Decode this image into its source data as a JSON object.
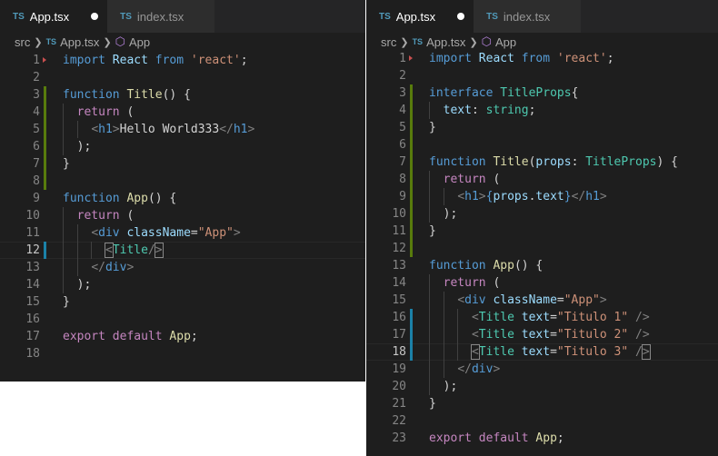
{
  "left": {
    "tabs": [
      {
        "icon": "TS",
        "label": "App.tsx",
        "active": true,
        "dirty": true
      },
      {
        "icon": "TS",
        "label": "index.tsx",
        "active": false,
        "dirty": false
      }
    ],
    "breadcrumb": {
      "folder": "src",
      "file_icon": "TS",
      "file": "App.tsx",
      "symbol": "App"
    },
    "lines": [
      {
        "n": "1",
        "tokens": [
          [
            "kw",
            "import"
          ],
          [
            "pl",
            " "
          ],
          [
            "id",
            "React"
          ],
          [
            "pl",
            " "
          ],
          [
            "kw",
            "from"
          ],
          [
            "pl",
            " "
          ],
          [
            "str",
            "'react'"
          ],
          [
            "pl",
            ";"
          ]
        ]
      },
      {
        "n": "2",
        "tokens": []
      },
      {
        "n": "3",
        "tokens": [
          [
            "kw",
            "function"
          ],
          [
            "pl",
            " "
          ],
          [
            "fn",
            "Title"
          ],
          [
            "pl",
            "() {"
          ]
        ]
      },
      {
        "n": "4",
        "tokens": [
          [
            "pl",
            "  "
          ],
          [
            "flow",
            "return"
          ],
          [
            "pl",
            " ("
          ]
        ]
      },
      {
        "n": "5",
        "tokens": [
          [
            "pl",
            "    "
          ],
          [
            "br",
            "<"
          ],
          [
            "tag",
            "h1"
          ],
          [
            "br",
            ">"
          ],
          [
            "pl",
            "Hello World333"
          ],
          [
            "br",
            "</"
          ],
          [
            "tag",
            "h1"
          ],
          [
            "br",
            ">"
          ]
        ]
      },
      {
        "n": "6",
        "tokens": [
          [
            "pl",
            "  );"
          ]
        ]
      },
      {
        "n": "7",
        "tokens": [
          [
            "pl",
            "}"
          ]
        ]
      },
      {
        "n": "8",
        "tokens": []
      },
      {
        "n": "9",
        "tokens": [
          [
            "kw",
            "function"
          ],
          [
            "pl",
            " "
          ],
          [
            "fn",
            "App"
          ],
          [
            "pl",
            "() {"
          ]
        ]
      },
      {
        "n": "10",
        "tokens": [
          [
            "pl",
            "  "
          ],
          [
            "flow",
            "return"
          ],
          [
            "pl",
            " ("
          ]
        ]
      },
      {
        "n": "11",
        "tokens": [
          [
            "pl",
            "    "
          ],
          [
            "br",
            "<"
          ],
          [
            "tag",
            "div"
          ],
          [
            "pl",
            " "
          ],
          [
            "id",
            "className"
          ],
          [
            "pl",
            "="
          ],
          [
            "str",
            "\"App\""
          ],
          [
            "br",
            ">"
          ]
        ]
      },
      {
        "n": "12",
        "tokens": [
          [
            "pl",
            "      "
          ],
          [
            "brbox",
            "<"
          ],
          [
            "type",
            "Title"
          ],
          [
            "br",
            "/"
          ],
          [
            "brbox",
            ">"
          ]
        ]
      },
      {
        "n": "13",
        "tokens": [
          [
            "pl",
            "    "
          ],
          [
            "br",
            "</"
          ],
          [
            "tag",
            "div"
          ],
          [
            "br",
            ">"
          ]
        ]
      },
      {
        "n": "14",
        "tokens": [
          [
            "pl",
            "  );"
          ]
        ]
      },
      {
        "n": "15",
        "tokens": [
          [
            "pl",
            "}"
          ]
        ]
      },
      {
        "n": "16",
        "tokens": []
      },
      {
        "n": "17",
        "tokens": [
          [
            "flow",
            "export"
          ],
          [
            "pl",
            " "
          ],
          [
            "flow",
            "default"
          ],
          [
            "pl",
            " "
          ],
          [
            "fn",
            "App"
          ],
          [
            "pl",
            ";"
          ]
        ]
      },
      {
        "n": "18",
        "tokens": []
      }
    ]
  },
  "right": {
    "tabs": [
      {
        "icon": "TS",
        "label": "App.tsx",
        "active": true,
        "dirty": true
      },
      {
        "icon": "TS",
        "label": "index.tsx",
        "active": false,
        "dirty": false
      }
    ],
    "breadcrumb": {
      "folder": "src",
      "file_icon": "TS",
      "file": "App.tsx",
      "symbol": "App"
    },
    "lines": [
      {
        "n": "1",
        "tokens": [
          [
            "kw",
            "import"
          ],
          [
            "pl",
            " "
          ],
          [
            "id",
            "React"
          ],
          [
            "pl",
            " "
          ],
          [
            "kw",
            "from"
          ],
          [
            "pl",
            " "
          ],
          [
            "str",
            "'react'"
          ],
          [
            "pl",
            ";"
          ]
        ]
      },
      {
        "n": "2",
        "tokens": []
      },
      {
        "n": "3",
        "tokens": [
          [
            "kw",
            "interface"
          ],
          [
            "pl",
            " "
          ],
          [
            "type",
            "TitleProps"
          ],
          [
            "pl",
            "{"
          ]
        ]
      },
      {
        "n": "4",
        "tokens": [
          [
            "pl",
            "  "
          ],
          [
            "id",
            "text"
          ],
          [
            "pl",
            ": "
          ],
          [
            "type",
            "string"
          ],
          [
            "pl",
            ";"
          ]
        ]
      },
      {
        "n": "5",
        "tokens": [
          [
            "pl",
            "}"
          ]
        ]
      },
      {
        "n": "6",
        "tokens": []
      },
      {
        "n": "7",
        "tokens": [
          [
            "kw",
            "function"
          ],
          [
            "pl",
            " "
          ],
          [
            "fn",
            "Title"
          ],
          [
            "pl",
            "("
          ],
          [
            "id",
            "props"
          ],
          [
            "pl",
            ": "
          ],
          [
            "type",
            "TitleProps"
          ],
          [
            "pl",
            ") {"
          ]
        ]
      },
      {
        "n": "8",
        "tokens": [
          [
            "pl",
            "  "
          ],
          [
            "flow",
            "return"
          ],
          [
            "pl",
            " ("
          ]
        ]
      },
      {
        "n": "9",
        "tokens": [
          [
            "pl",
            "    "
          ],
          [
            "br",
            "<"
          ],
          [
            "tag",
            "h1"
          ],
          [
            "br",
            ">"
          ],
          [
            "kw",
            "{"
          ],
          [
            "id",
            "props"
          ],
          [
            "pl",
            "."
          ],
          [
            "id",
            "text"
          ],
          [
            "kw",
            "}"
          ],
          [
            "br",
            "</"
          ],
          [
            "tag",
            "h1"
          ],
          [
            "br",
            ">"
          ]
        ]
      },
      {
        "n": "10",
        "tokens": [
          [
            "pl",
            "  );"
          ]
        ]
      },
      {
        "n": "11",
        "tokens": [
          [
            "pl",
            "}"
          ]
        ]
      },
      {
        "n": "12",
        "tokens": []
      },
      {
        "n": "13",
        "tokens": [
          [
            "kw",
            "function"
          ],
          [
            "pl",
            " "
          ],
          [
            "fn",
            "App"
          ],
          [
            "pl",
            "() {"
          ]
        ]
      },
      {
        "n": "14",
        "tokens": [
          [
            "pl",
            "  "
          ],
          [
            "flow",
            "return"
          ],
          [
            "pl",
            " ("
          ]
        ]
      },
      {
        "n": "15",
        "tokens": [
          [
            "pl",
            "    "
          ],
          [
            "br",
            "<"
          ],
          [
            "tag",
            "div"
          ],
          [
            "pl",
            " "
          ],
          [
            "id",
            "className"
          ],
          [
            "pl",
            "="
          ],
          [
            "str",
            "\"App\""
          ],
          [
            "br",
            ">"
          ]
        ]
      },
      {
        "n": "16",
        "tokens": [
          [
            "pl",
            "      "
          ],
          [
            "br",
            "<"
          ],
          [
            "type",
            "Title"
          ],
          [
            "pl",
            " "
          ],
          [
            "id",
            "text"
          ],
          [
            "pl",
            "="
          ],
          [
            "str",
            "\"Titulo 1\""
          ],
          [
            "pl",
            " "
          ],
          [
            "br",
            "/>"
          ]
        ]
      },
      {
        "n": "17",
        "tokens": [
          [
            "pl",
            "      "
          ],
          [
            "br",
            "<"
          ],
          [
            "type",
            "Title"
          ],
          [
            "pl",
            " "
          ],
          [
            "id",
            "text"
          ],
          [
            "pl",
            "="
          ],
          [
            "str",
            "\"Titulo 2\""
          ],
          [
            "pl",
            " "
          ],
          [
            "br",
            "/>"
          ]
        ]
      },
      {
        "n": "18",
        "tokens": [
          [
            "pl",
            "      "
          ],
          [
            "brbox",
            "<"
          ],
          [
            "type",
            "Title"
          ],
          [
            "pl",
            " "
          ],
          [
            "id",
            "text"
          ],
          [
            "pl",
            "="
          ],
          [
            "str",
            "\"Titulo 3\""
          ],
          [
            "pl",
            " "
          ],
          [
            "br",
            "/"
          ],
          [
            "brbox",
            ">"
          ]
        ]
      },
      {
        "n": "19",
        "tokens": [
          [
            "pl",
            "    "
          ],
          [
            "br",
            "</"
          ],
          [
            "tag",
            "div"
          ],
          [
            "br",
            ">"
          ]
        ]
      },
      {
        "n": "20",
        "tokens": [
          [
            "pl",
            "  );"
          ]
        ]
      },
      {
        "n": "21",
        "tokens": [
          [
            "pl",
            "}"
          ]
        ]
      },
      {
        "n": "22",
        "tokens": []
      },
      {
        "n": "23",
        "tokens": [
          [
            "flow",
            "export"
          ],
          [
            "pl",
            " "
          ],
          [
            "flow",
            "default"
          ],
          [
            "pl",
            " "
          ],
          [
            "fn",
            "App"
          ],
          [
            "pl",
            ";"
          ]
        ]
      }
    ]
  },
  "colors": {
    "editor_bg": "#1e1e1e",
    "tab_inactive_bg": "#2d2d2d",
    "keyword": "#569cd6",
    "control_keyword": "#c586c0",
    "function": "#dcdcaa",
    "type": "#4ec9b0",
    "string": "#ce9178",
    "variable": "#9cdcfe",
    "gutter_modified": "#587c0c",
    "gutter_changed": "#1b81a8"
  }
}
